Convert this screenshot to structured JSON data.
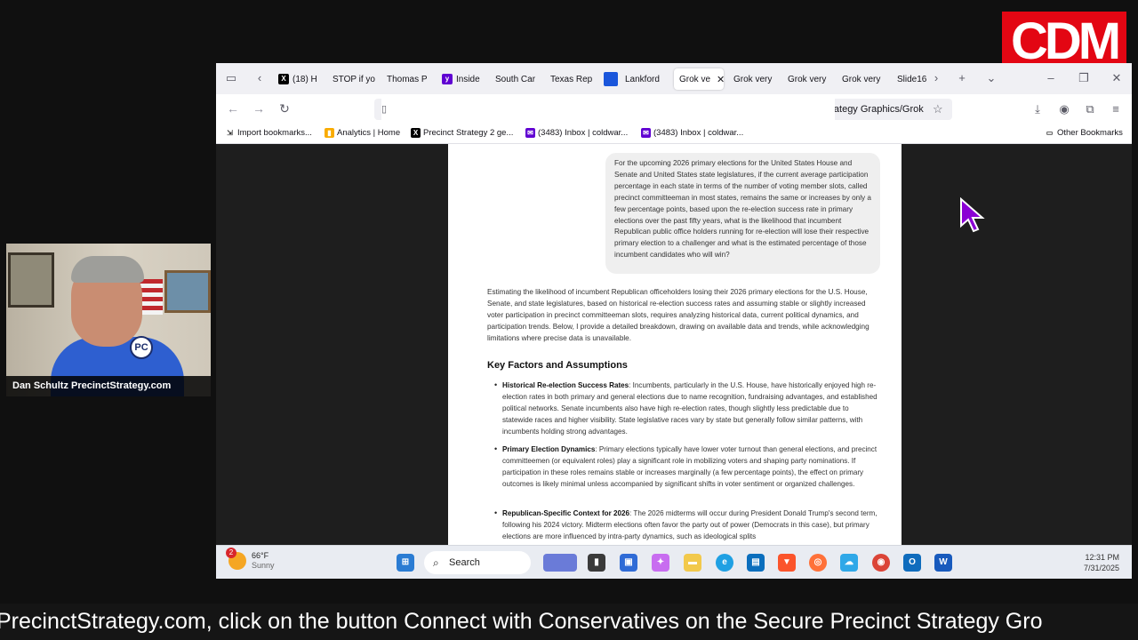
{
  "logo": {
    "text": "CDM"
  },
  "webcam": {
    "name_tag": "Dan Schultz PrecinctStrategy.com",
    "badge": "PC"
  },
  "browser": {
    "tabs": [
      {
        "label": "(18) H",
        "icon": "x-logo-icon",
        "color": "#000000"
      },
      {
        "label": "STOP if yo",
        "icon": "none"
      },
      {
        "label": "Thomas P",
        "icon": "none"
      },
      {
        "label": "Inside",
        "icon": "yahoo-icon",
        "color": "#6001d2"
      },
      {
        "label": "South Car",
        "icon": "none"
      },
      {
        "label": "Texas Rep",
        "icon": "none"
      },
      {
        "label": "",
        "icon": "blue-square-icon",
        "color": "#1a56db"
      },
      {
        "label": "Lankford",
        "icon": "none"
      },
      {
        "label": "Grok ve",
        "icon": "none",
        "active": true
      },
      {
        "label": "Grok very",
        "icon": "none"
      },
      {
        "label": "Grok very",
        "icon": "none"
      },
      {
        "label": "Grok very",
        "icon": "none"
      },
      {
        "label": "Slide16",
        "icon": "none"
      }
    ],
    "url": "file:///C:/Users/dan/OneDrive/Pictures/Precinct Committeeman Strategy/Frequently Used Precinct Strategy Graphics/Grok",
    "bookmarks": [
      {
        "label": "Import bookmarks..."
      },
      {
        "label": "Analytics | Home"
      },
      {
        "label": "Precinct Strategy 2 ge..."
      },
      {
        "label": "(3483) Inbox | coldwar..."
      },
      {
        "label": "(3483) Inbox | coldwar..."
      }
    ],
    "other_bookmarks": "Other Bookmarks"
  },
  "document": {
    "prompt": "For the upcoming 2026 primary elections for the United States House and Senate and United States state legislatures, if the current average participation percentage in each state in terms of the number of voting member slots, called precinct committeeman in most states, remains the same or increases by only a few percentage points, based upon the re-election success rate in primary elections over the past fifty years, what is the likelihood that incumbent Republican public office holders running for re-election will lose their respective primary election to a challenger and what is the estimated percentage of those incumbent candidates who will win?",
    "intro": "Estimating the likelihood of incumbent Republican officeholders losing their 2026 primary elections for the U.S. House, Senate, and state legislatures, based on historical re-election success rates and assuming stable or slightly increased voter participation in precinct committeeman slots, requires analyzing historical data, current political dynamics, and participation trends. Below, I provide a detailed breakdown, drawing on available data and trends, while acknowledging limitations where precise data is unavailable.",
    "heading": "Key Factors and Assumptions",
    "bullets": [
      {
        "title": "Historical Re-election Success Rates",
        "text": ": Incumbents, particularly in the U.S. House, have historically enjoyed high re-election rates in both primary and general elections due to name recognition, fundraising advantages, and established political networks. Senate incumbents also have high re-election rates, though slightly less predictable due to statewide races and higher visibility. State legislative races vary by state but generally follow similar patterns, with incumbents holding strong advantages."
      },
      {
        "title": "Primary Election Dynamics",
        "text": ": Primary elections typically have lower voter turnout than general elections, and precinct committeemen (or equivalent roles) play a significant role in mobilizing voters and shaping party nominations. If participation in these roles remains stable or increases marginally (a few percentage points), the effect on primary outcomes is likely minimal unless accompanied by significant shifts in voter sentiment or organized challenges."
      },
      {
        "title": "Republican-Specific Context for 2026",
        "text": ": The 2026 midterms will occur during President Donald Trump's second term, following his 2024 victory. Midterm elections often favor the party out of power (Democrats in this case), but primary elections are more influenced by intra-party dynamics, such as ideological splits"
      }
    ]
  },
  "taskbar": {
    "weather_temp": "66°F",
    "weather_desc": "Sunny",
    "weather_badge": "2",
    "search_label": "Search",
    "time": "12:31 PM",
    "date": "7/31/2025"
  },
  "ticker": "PrecinctStrategy.com, click on the button Connect with Conservatives on the Secure Precinct Strategy Gro"
}
